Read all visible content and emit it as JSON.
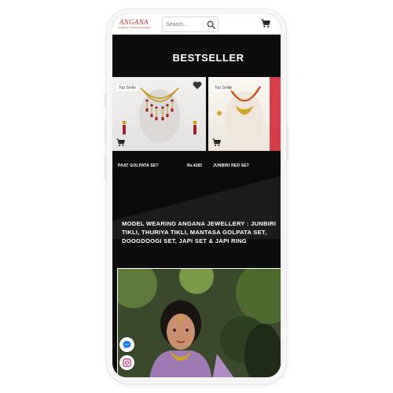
{
  "header": {
    "logo_name": "ANGANA",
    "logo_tagline": "Assamese Traditional Jewellery",
    "search_placeholder": "Search..."
  },
  "section_title": "BESTSELLER",
  "products": [
    {
      "badge": "Top Seller",
      "name": "PAAT GOLPATA SET",
      "price": "Rs.4183"
    },
    {
      "badge": "Top Seller",
      "name": "JUNBIRI RED SET",
      "price": ""
    }
  ],
  "model_text": [
    "MODEL WEARING ANGANA JEWELLERY : JUNBIRI",
    "TIKLI, THURIYA TIKLI, MANTASA GOLPATA SET,",
    "DOOGDOOGI SET, JAPI SET & JAPI RING"
  ],
  "social": [
    "messenger-icon",
    "instagram-icon"
  ],
  "colors": {
    "brand": "#c0392b",
    "background": "#0d0d0d",
    "gold": "#c9a227"
  }
}
